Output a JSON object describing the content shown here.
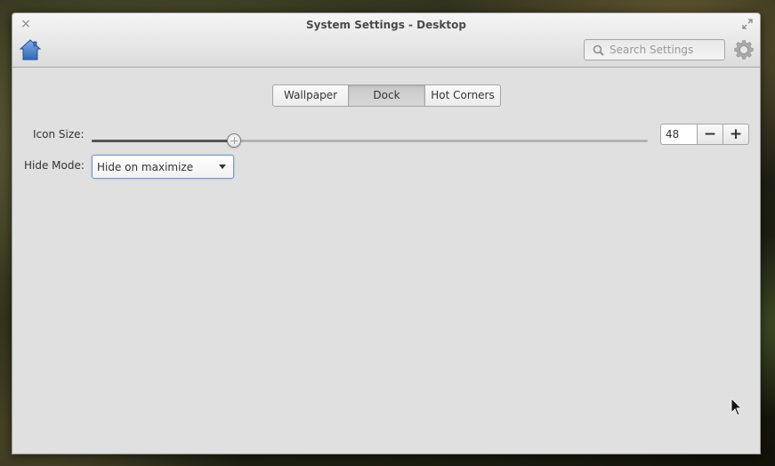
{
  "window": {
    "title": "System Settings - Desktop"
  },
  "header": {
    "home_icon": "home-icon",
    "search_placeholder": "Search Settings",
    "search_value": "",
    "settings_icon": "gear-icon"
  },
  "tabs": [
    {
      "label": "Wallpaper",
      "active": false
    },
    {
      "label": "Dock",
      "active": true
    },
    {
      "label": "Hot Corners",
      "active": false
    }
  ],
  "icon_size": {
    "label": "Icon Size:",
    "value": "48",
    "slider_fraction": 0.256,
    "decrement_label": "−",
    "increment_label": "+"
  },
  "hide_mode": {
    "label": "Hide Mode:",
    "selected": "Hide on maximize"
  },
  "colors": {
    "window_bg": "#e0e0e0",
    "focus_accent": "#6d9acb",
    "home_icon": "#3b7bc8"
  }
}
